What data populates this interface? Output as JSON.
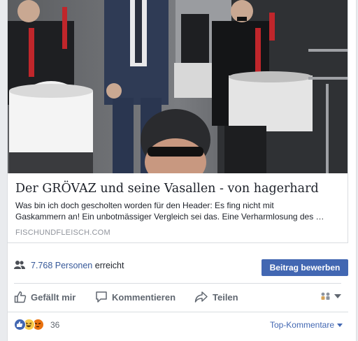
{
  "link_preview": {
    "title": "Der GRÖVAZ und seine Vasallen - von hagerhard",
    "description_lines": [
      "Was bin ich doch gescholten worden für den Header: Es fing nicht mit",
      "Gaskammern an! Ein unbotmässiger Vergleich sei das. Eine Verharmlosung des …"
    ],
    "domain": "FISCHUNDFLEISCH.COM"
  },
  "reach": {
    "count_link": "7.768 Personen",
    "suffix": "erreicht",
    "promote_button": "Beitrag bewerben"
  },
  "actions": {
    "like": "Gefällt mir",
    "comment": "Kommentieren",
    "share": "Teilen"
  },
  "reactions": {
    "count": "36",
    "top_comments": "Top-Kommentare"
  },
  "colors": {
    "link": "#365899",
    "button": "#4267b2",
    "action_text": "#606770"
  },
  "icons": [
    "people-icon",
    "thumbs-up-icon",
    "comment-icon",
    "share-icon",
    "audience-icon",
    "like-reaction-icon",
    "haha-reaction-icon",
    "angry-reaction-icon"
  ]
}
